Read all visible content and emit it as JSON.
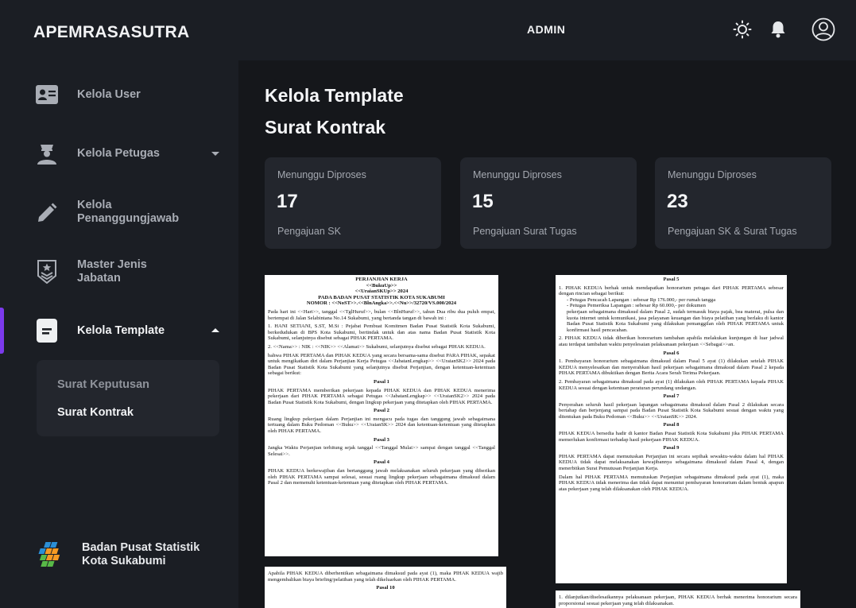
{
  "header": {
    "brand": "APEMRASASUTRA",
    "role": "ADMIN"
  },
  "icons": {
    "theme": "sun-icon",
    "notify": "bell-icon",
    "profile": "user-circle-icon"
  },
  "sidebar": {
    "items": [
      {
        "label": "Kelola User",
        "icon": "id-card-icon"
      },
      {
        "label": "Kelola Petugas",
        "icon": "officer-icon"
      },
      {
        "label": "Kelola Penanggungjawab",
        "line1": "Kelola",
        "line2": "Penanggungjawab",
        "icon": "pencil-icon"
      },
      {
        "label": "Master Jenis Jabatan",
        "line1": "Master Jenis",
        "line2": "Jabatan",
        "icon": "rank-badge-icon"
      },
      {
        "label": "Kelola Template",
        "icon": "document-icon"
      }
    ],
    "submenu": [
      "Surat Keputusan",
      "Surat Kontrak"
    ],
    "footer": {
      "line1": "Badan Pusat Statistik",
      "line2": "Kota Sukabumi"
    },
    "accent": "#7c3aed"
  },
  "main": {
    "title_line1": "Kelola Template",
    "title_line2": "Surat Kontrak",
    "cards": [
      {
        "caption": "Menunggu Diproses",
        "count": "17",
        "label": "Pengajuan SK"
      },
      {
        "caption": "Menunggu Diproses",
        "count": "15",
        "label": "Pengajuan Surat Tugas"
      },
      {
        "caption": "Menunggu Diproses",
        "count": "23",
        "label": "Pengajuan SK & Surat Tugas"
      }
    ]
  },
  "docs": {
    "p1": {
      "h1": "PERJANJIAN KERJA",
      "h2": "<<BukuUp>>",
      "h3": "<<UraianSKUp>> 2024",
      "h4": "PADA BADAN PUSAT STATISTIK KOTA SUKABUMI",
      "h5": "NOMOR : <<NoST>>.<<BlnAngka>>.<<Nu>>/32720/VS.000/2024",
      "intro": "Pada hari ini <<Hari>>, tanggal <<TglHuruf>>, bulan <<BlnHuruf>>, tahun Dua ribu dua puluh empat, bertempat di Jalan Selabintana No.14 Sukabumi, yang bertanda tangan di bawah ini :",
      "party1": "1. HANI SETIANI, S.ST, M.Si : Pejabat Pembuat Komitmen Badan Pusat Statistik Kota Sukabumi, berkedudukan di BPS Kota Sukabumi, bertindak untuk dan atas nama Badan Pusat Statistik Kota Sukabumi, selanjutnya disebut sebagai PIHAK PERTAMA.",
      "party2": "2. <<Nama>> : NIK : <<NIK>> <<Alamat>> Sukabumi, selanjutnya disebut sebagai PIHAK KEDUA.",
      "agree": "bahwa PIHAK PERTAMA dan PIHAK KEDUA yang secara bersama-sama disebut PARA PIHAK, sepakat untuk mengikatkan diri dalam Perjanjian Kerja Petugas <<JabatanLengkap>> <<UraianSK2>> 2024 pada Badan Pusat Statistik Kota Sukabumi yang selanjutnya disebut Perjanjian, dengan ketentuan-ketentuan sebagai berikut:",
      "s1": "Pasal 1",
      "t1": "PIHAK PERTAMA memberikan pekerjaan kepada PIHAK KEDUA dan PIHAK KEDUA menerima pekerjaan dari PIHAK PERTAMA sebagai Petugas <<JabatanLengkap>> <<UraianSK2>> 2024 pada Badan Pusat Statistik Kota Sukabumi, dengan lingkup pekerjaan yang ditetapkan oleh PIHAK PERTAMA.",
      "s2": "Pasal 2",
      "t2": "Ruang lingkup pekerjaan dalam Perjanjian ini mengacu pada tugas dan tanggung jawab sebagaimana tertuang dalam Buku Pedoman <<Buku>> <<UraianSK>> 2024 dan ketentuan-ketentuan yang ditetapkan oleh PIHAK PERTAMA.",
      "s3": "Pasal 3",
      "t3": "Jangka Waktu Perjanjian terhitung sejak tanggal <<Tanggal Mulai>> sampai dengan tanggal <<Tanggal Selesai>>.",
      "s4": "Pasal 4",
      "t4": "PIHAK KEDUA berkewajiban dan bertanggung jawab melaksanakan seluruh pekerjaan yang diberikan oleh PIHAK PERTAMA sampai selesai, sesuai ruang lingkup pekerjaan sebagaimana dimaksud dalam Pasal 2 dan memenuhi ketentuan-ketentuan yang ditetapkan oleh PIHAK PERTAMA."
    },
    "p2": {
      "t1": "Apabila PIHAK KEDUA diberhentikan sebagaimana dimaksud pada ayat (1), maka PIHAK KEDUA wajib mengembalikan biaya briefing/pelatihan yang telah dikeluarkan oleh PIHAK PERTAMA.",
      "s1": "Pasal 10"
    },
    "p3": {
      "s5": "Pasal 5",
      "t5a": "1. PIHAK KEDUA berhak untuk mendapatkan honorarium petugas dari PIHAK PERTAMA sebesar dengan rincian sebagai berikut:",
      "t5b": "- Petugas Pencacah Lapangan : sebesar Rp 176.000,- per rumah tangga",
      "t5c": "- Petugas Pemeriksa Lapangan : sebesar Rp 60.000,- per dokumen",
      "t5d": "pekerjaan sebagaimana dimaksud dalam Pasal 2, sudah termasuk biaya pajak, bea materai, pulsa dan kuota internet untuk komunikasi, jasa pelayanan keuangan dan biaya pelatihan yang berlaku di kantor Badan Pusat Statistik Kota Sukabumi yang dilakukan pemanggilan oleh PIHAK PERTAMA untuk konfirmasi hasil pencacahan.",
      "t5e": "2. PIHAK KEDUA tidak diberikan honorarium tambahan apabila melakukan kunjungan di luar jadwal atau terdapat tambahan waktu penyelesaian pelaksanaan pekerjaan <<Sebagai>>an.",
      "s6": "Pasal 6",
      "t6a": "1. Pembayaran honorarium sebagaimana dimaksud dalam Pasal 5 ayat (1) dilakukan setelah PIHAK KEDUA menyelesaikan dan menyerahkan hasil pekerjaan sebagaimana dimaksud dalam Pasal 2 kepada PIHAK PERTAMA dibuktikan dengan Berita Acara Serah Terima Pekerjaan.",
      "t6b": "2. Pembayaran sebagaimana dimaksud pada ayat (1) dilakukan oleh PIHAK PERTAMA kepada PIHAK KEDUA sesuai dengan ketentuan peraturan perundang undangan.",
      "s7": "Pasal 7",
      "t7": "Penyerahan seluruh hasil pekerjaan lapangan sebagaimana dimaksud dalam Pasal 2 dilakukan secara bertahap dan berjenjang sampai pada Badan Pusat Statistik Kota Sukabumi sesuai dengan waktu yang ditentukan pada Buku Pedoman <<Buku>> <<UraianSK>> 2024.",
      "s8": "Pasal 8",
      "t8": "PIHAK KEDUA bersedia hadir di kantor Badan Pusat Statistik Kota Sukabumi jika PIHAK PERTAMA memerlukan konfirmasi terhadap hasil pekerjaan PIHAK KEDUA.",
      "s9": "Pasal 9",
      "t9a": "PIHAK PERTAMA dapat memutuskan Perjanjian ini secara sepihak sewaktu-waktu dalam hal PIHAK KEDUA tidak dapat melaksanakan kewajibannya sebagaimana dimaksud dalam Pasal 4, dengan menerbitkan Surat Pemutusan Perjanjian Kerja.",
      "t9b": "Dalam hal PIHAK PERTAMA memutuskan Perjanjian sebagaimana dimaksud pada ayat (1), maka PIHAK KEDUA tidak menerima dan tidak dapat menuntut pembayaran honorarium dalam bentuk apapun atas pekerjaan yang telah dilaksanakan oleh PIHAK KEDUA."
    },
    "p4": {
      "t1": "1. dilanjutkan/diselesaikannya pelaksanaan pekerjaan, PIHAK KEDUA berhak menerima honorarium secara proporsional sesuai pekerjaan yang telah dilaksanakan."
    }
  }
}
